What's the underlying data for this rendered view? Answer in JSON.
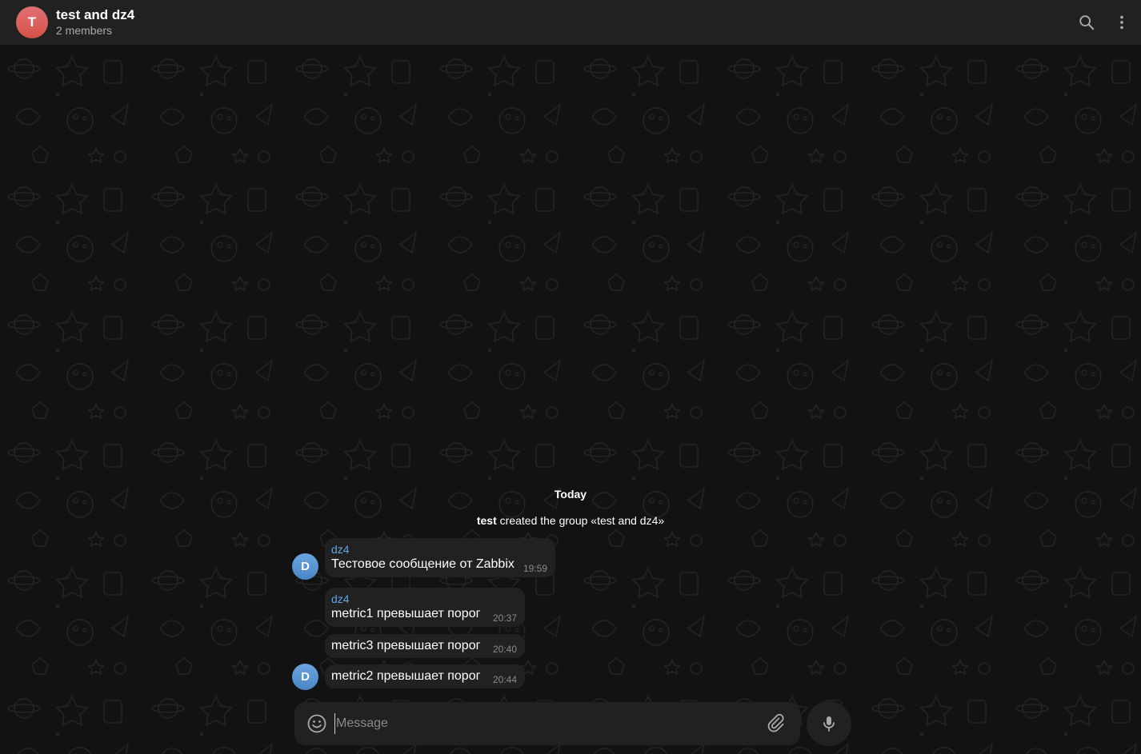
{
  "header": {
    "avatar_letter": "T",
    "title": "test and dz4",
    "subtitle": "2 members",
    "search_icon": "search-icon",
    "more_icon": "more-vertical-icon"
  },
  "service": {
    "date": "Today",
    "action_actor": "test",
    "action_text": " created the group «test and dz4»"
  },
  "messages": [
    {
      "sender": "dz4",
      "text": "Тестовое сообщение от Zabbix",
      "time": "19:59",
      "avatar": "D"
    },
    {
      "sender": "dz4",
      "text": "metric1 превышает порог",
      "time": "20:37"
    },
    {
      "text": "metric3 превышает порог",
      "time": "20:40"
    },
    {
      "text": "metric2 превышает порог",
      "time": "20:44",
      "avatar": "D"
    }
  ],
  "composer": {
    "placeholder": "Message",
    "emoji_icon": "smile-icon",
    "attach_icon": "paperclip-icon",
    "mic_icon": "microphone-icon"
  },
  "colors": {
    "header_bg": "#212121",
    "bubble_bg": "#212121",
    "sender_color": "#5fa6e6",
    "group_avatar": "#e17076",
    "user_avatar": "#5a96d6"
  }
}
